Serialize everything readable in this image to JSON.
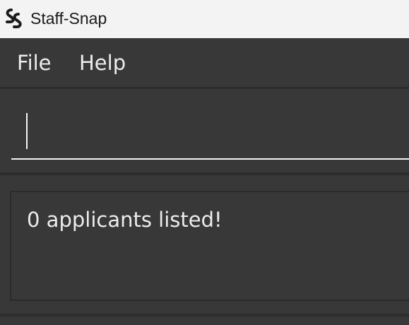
{
  "window": {
    "title": "Staff-Snap",
    "logo_icon": "staff-snap-logo-icon"
  },
  "menu": {
    "items": [
      {
        "label": "File"
      },
      {
        "label": "Help"
      }
    ]
  },
  "command_box": {
    "value": "",
    "placeholder": ""
  },
  "result_display": {
    "text": "0 applicants listed!"
  },
  "colors": {
    "titlebar_bg": "#f3f3f3",
    "app_bg": "#383838",
    "divider": "#2d2d2d",
    "text": "#ececec"
  }
}
